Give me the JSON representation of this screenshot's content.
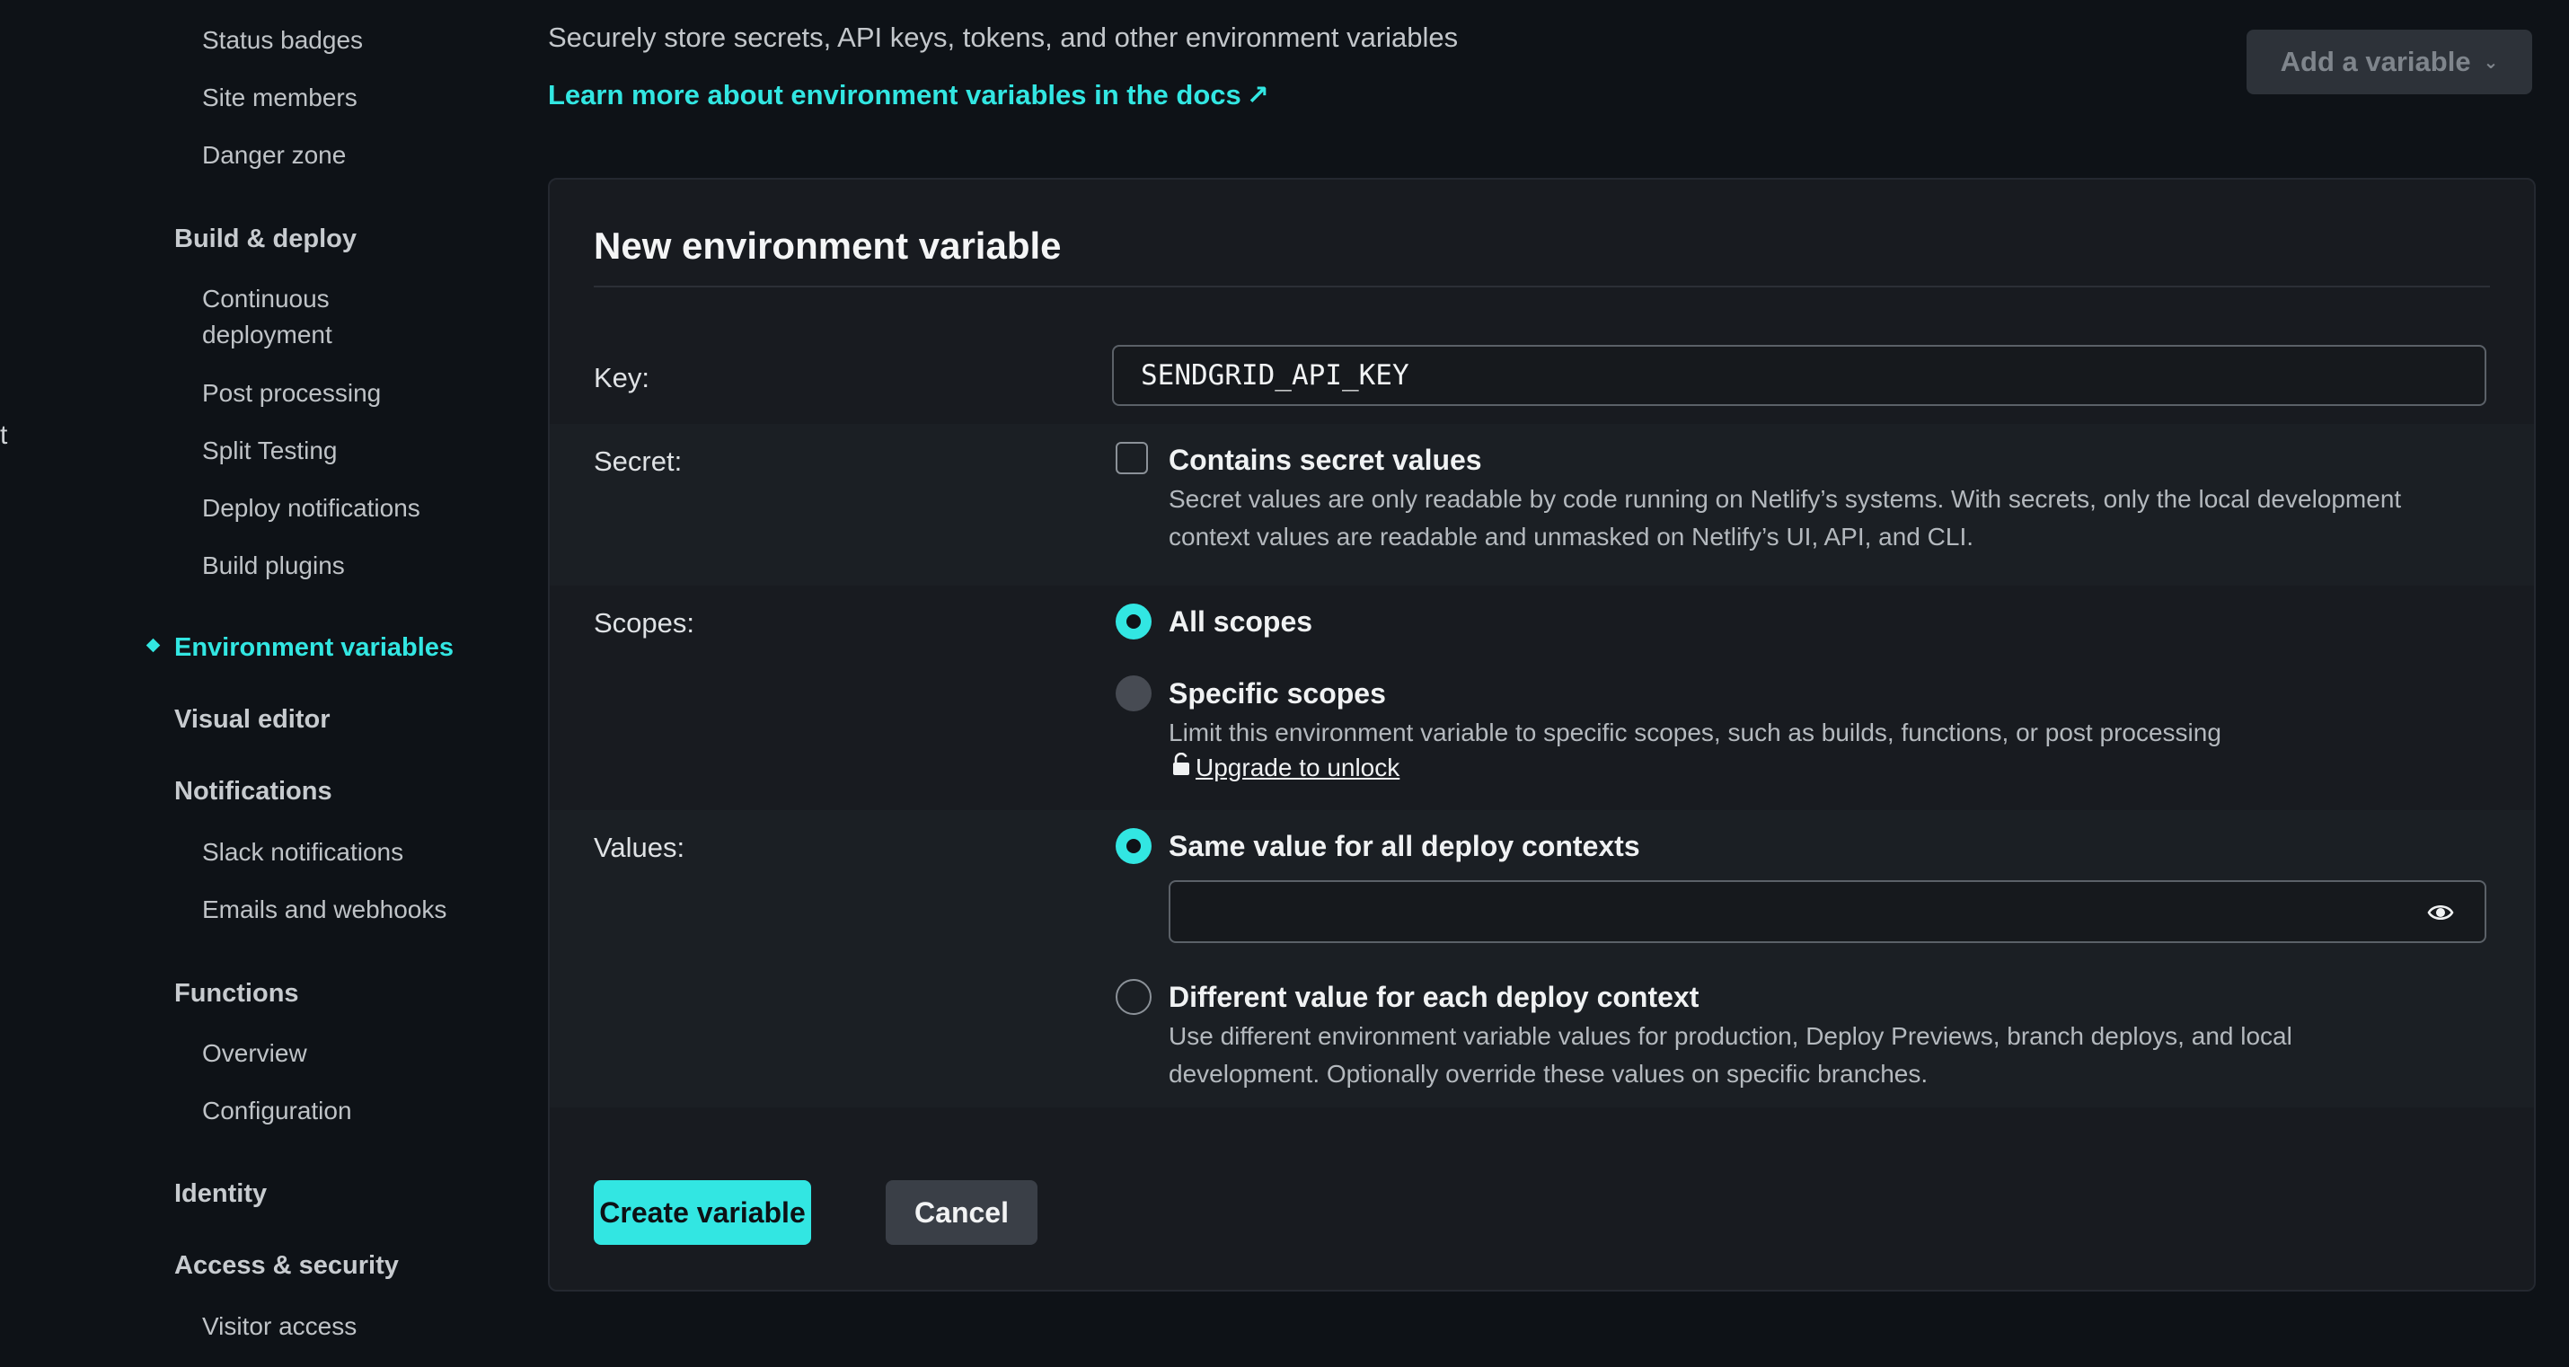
{
  "sidebar": {
    "edge_fragment": "t",
    "general_items": [
      "Status badges",
      "Site members",
      "Danger zone"
    ],
    "build_deploy": {
      "heading": "Build & deploy",
      "items": [
        "Continuous",
        "deployment",
        "Post processing",
        "Split Testing",
        "Deploy notifications",
        "Build plugins"
      ]
    },
    "environment_variables": "Environment variables",
    "visual_editor": "Visual editor",
    "notifications": {
      "heading": "Notifications",
      "items": [
        "Slack notifications",
        "Emails and webhooks"
      ]
    },
    "functions": {
      "heading": "Functions",
      "items": [
        "Overview",
        "Configuration"
      ]
    },
    "identity": "Identity",
    "access_security": {
      "heading": "Access & security",
      "items": [
        "Visitor access"
      ]
    }
  },
  "header": {
    "intro": "Securely store secrets, API keys, tokens, and other environment variables",
    "docs_link": "Learn more about environment variables in the docs",
    "docs_arrow": "↗",
    "add_button": "Add a variable",
    "add_chevron": "⌄"
  },
  "form": {
    "title": "New environment variable",
    "key": {
      "label": "Key:",
      "value": "SENDGRID_API_KEY"
    },
    "secret": {
      "label": "Secret:",
      "option": "Contains secret values",
      "description_line1": "Secret values are only readable by code running on Netlify’s systems. With secrets, only the local development",
      "description_line2": "context values are readable and unmasked on Netlify’s UI, API, and CLI."
    },
    "scopes": {
      "label": "Scopes:",
      "all": "All scopes",
      "specific": "Specific scopes",
      "specific_desc": "Limit this environment variable to specific scopes, such as builds, functions, or post processing",
      "upgrade": "Upgrade to unlock"
    },
    "values": {
      "label": "Values:",
      "same": "Same value for all deploy contexts",
      "value": "",
      "different": "Different value for each deploy context",
      "different_desc_line1": "Use different environment variable values for production, Deploy Previews, branch deploys, and local",
      "different_desc_line2": "development. Optionally override these values on specific branches."
    },
    "create_button": "Create variable",
    "cancel_button": "Cancel"
  },
  "colors": {
    "accent": "#32e6e2",
    "background": "#0e1217",
    "card": "#181b20"
  }
}
